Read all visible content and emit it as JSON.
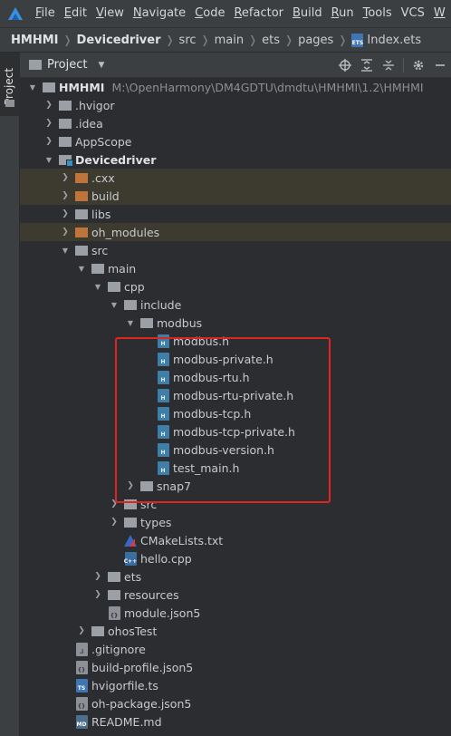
{
  "menubar": {
    "items": [
      {
        "mnemonic": "F",
        "rest": "ile"
      },
      {
        "mnemonic": "E",
        "rest": "dit"
      },
      {
        "mnemonic": "V",
        "rest": "iew"
      },
      {
        "mnemonic": "N",
        "rest": "avigate"
      },
      {
        "mnemonic": "C",
        "rest": "ode"
      },
      {
        "mnemonic": "R",
        "rest": "efactor"
      },
      {
        "mnemonic": "B",
        "rest": "uild"
      },
      {
        "mnemonic": "R",
        "rest": "un"
      },
      {
        "mnemonic": "T",
        "rest": "ools"
      },
      {
        "mnemonic": "",
        "rest": "VCS"
      },
      {
        "mnemonic": "W",
        "rest": ""
      }
    ]
  },
  "breadcrumb": {
    "items": [
      "HMHMI",
      "Devicedriver",
      "src",
      "main",
      "ets",
      "pages"
    ],
    "file": "Index.ets"
  },
  "tool_strip": {
    "project_label": "Project"
  },
  "panel": {
    "view_label": "Project"
  },
  "tree": {
    "rows": [
      {
        "label": "HMHMI",
        "path": "M:\\OpenHarmony\\DM4GDTU\\dmdtu\\HMHMI\\1.2\\HMHMI"
      },
      {
        "label": ".hvigor"
      },
      {
        "label": ".idea"
      },
      {
        "label": "AppScope"
      },
      {
        "label": "Devicedriver"
      },
      {
        "label": ".cxx"
      },
      {
        "label": "build"
      },
      {
        "label": "libs"
      },
      {
        "label": "oh_modules"
      },
      {
        "label": "src"
      },
      {
        "label": "main"
      },
      {
        "label": "cpp"
      },
      {
        "label": "include"
      },
      {
        "label": "modbus"
      },
      {
        "label": "modbus.h"
      },
      {
        "label": "modbus-private.h"
      },
      {
        "label": "modbus-rtu.h"
      },
      {
        "label": "modbus-rtu-private.h"
      },
      {
        "label": "modbus-tcp.h"
      },
      {
        "label": "modbus-tcp-private.h"
      },
      {
        "label": "modbus-version.h"
      },
      {
        "label": "test_main.h"
      },
      {
        "label": "snap7"
      },
      {
        "label": "src"
      },
      {
        "label": "types"
      },
      {
        "label": "CMakeLists.txt"
      },
      {
        "label": "hello.cpp"
      },
      {
        "label": "ets"
      },
      {
        "label": "resources"
      },
      {
        "label": "module.json5"
      },
      {
        "label": "ohosTest"
      },
      {
        "label": ".gitignore"
      },
      {
        "label": "build-profile.json5"
      },
      {
        "label": "hvigorfile.ts"
      },
      {
        "label": "oh-package.json5"
      },
      {
        "label": "README.md"
      }
    ]
  },
  "colors": {
    "annotation_box": "#e02420",
    "excluded_folder": "#c0743a",
    "highlight_row": "#3d3b30"
  }
}
